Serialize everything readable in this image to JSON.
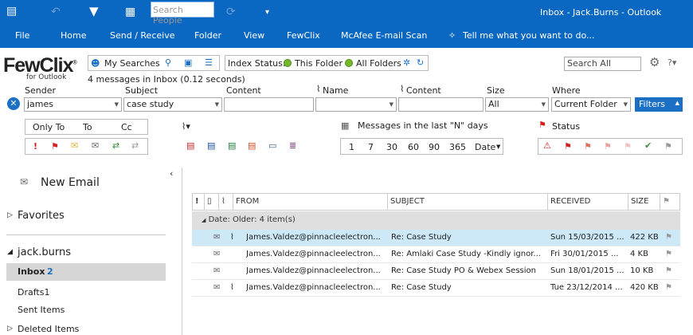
{
  "qat": {
    "search_placeholder": "Search People",
    "title": "Inbox - Jack.Burns - Outlook"
  },
  "tabs": [
    "File",
    "Home",
    "Send / Receive",
    "Folder",
    "View",
    "FewClix",
    "McAfee E-mail Scan",
    "Tell me what you want to do..."
  ],
  "fewclix": {
    "logo": "FewClix",
    "logo_sub": "for Outlook",
    "my_searches": "My Searches",
    "index_status_label": "Index Status:",
    "this_folder": "This Folder",
    "all_folders": "All Folders",
    "inbox_count": "4 messages in Inbox (0.12 seconds)",
    "search_all_placeholder": "Search All",
    "fields": {
      "sender_label": "Sender",
      "sender_value": "james",
      "subject_label": "Subject",
      "subject_value": "case study",
      "content_label": "Content",
      "name_label": "Name",
      "content2_label": "Content",
      "size_label": "Size",
      "size_value": "All",
      "where_label": "Where",
      "where_value": "Current Folder",
      "filters_button": "Filters"
    },
    "quick": {
      "only_to": "Only To",
      "to": "To",
      "cc": "Cc",
      "messages_label": "Messages in the last \"N\" days",
      "days": [
        "1",
        "7",
        "30",
        "60",
        "90",
        "365",
        "Date"
      ],
      "status_label": "Status"
    }
  },
  "nav": {
    "new_email": "New Email",
    "favorites": "Favorites",
    "account": "jack.burns",
    "inbox": "Inbox",
    "inbox_count": "2",
    "drafts": "Drafts1",
    "sent": "Sent Items",
    "deleted": "Deleted Items"
  },
  "mail": {
    "headers": {
      "from": "FROM",
      "subject": "SUBJECT",
      "received": "RECEIVED",
      "size": "SIZE"
    },
    "group": "Date: Older: 4 item(s)",
    "rows": [
      {
        "from": "James.Valdez@pinnacleelectron...",
        "subject": "Re: Case Study",
        "received": "Sun 15/03/2015 ...",
        "size": "422 KB",
        "attach": true,
        "selected": true
      },
      {
        "from": "James.Valdez@pinnacleelectron...",
        "subject": "Re: Amlaki Case Study -Kindly ignor...",
        "received": "Fri 30/01/2015 ...",
        "size": "4 KB",
        "attach": false,
        "selected": false
      },
      {
        "from": "James.Valdez@pinnacleelectron...",
        "subject": "Re: Case Study PO & Webex Session",
        "received": "Sun 18/01/2015 ...",
        "size": "10 KB",
        "attach": false,
        "selected": false
      },
      {
        "from": "James.Valdez@pinnacleelectron...",
        "subject": "Re: Case Study",
        "received": "Tue 23/12/2014 ...",
        "size": "420 KB",
        "attach": true,
        "selected": false
      }
    ]
  }
}
